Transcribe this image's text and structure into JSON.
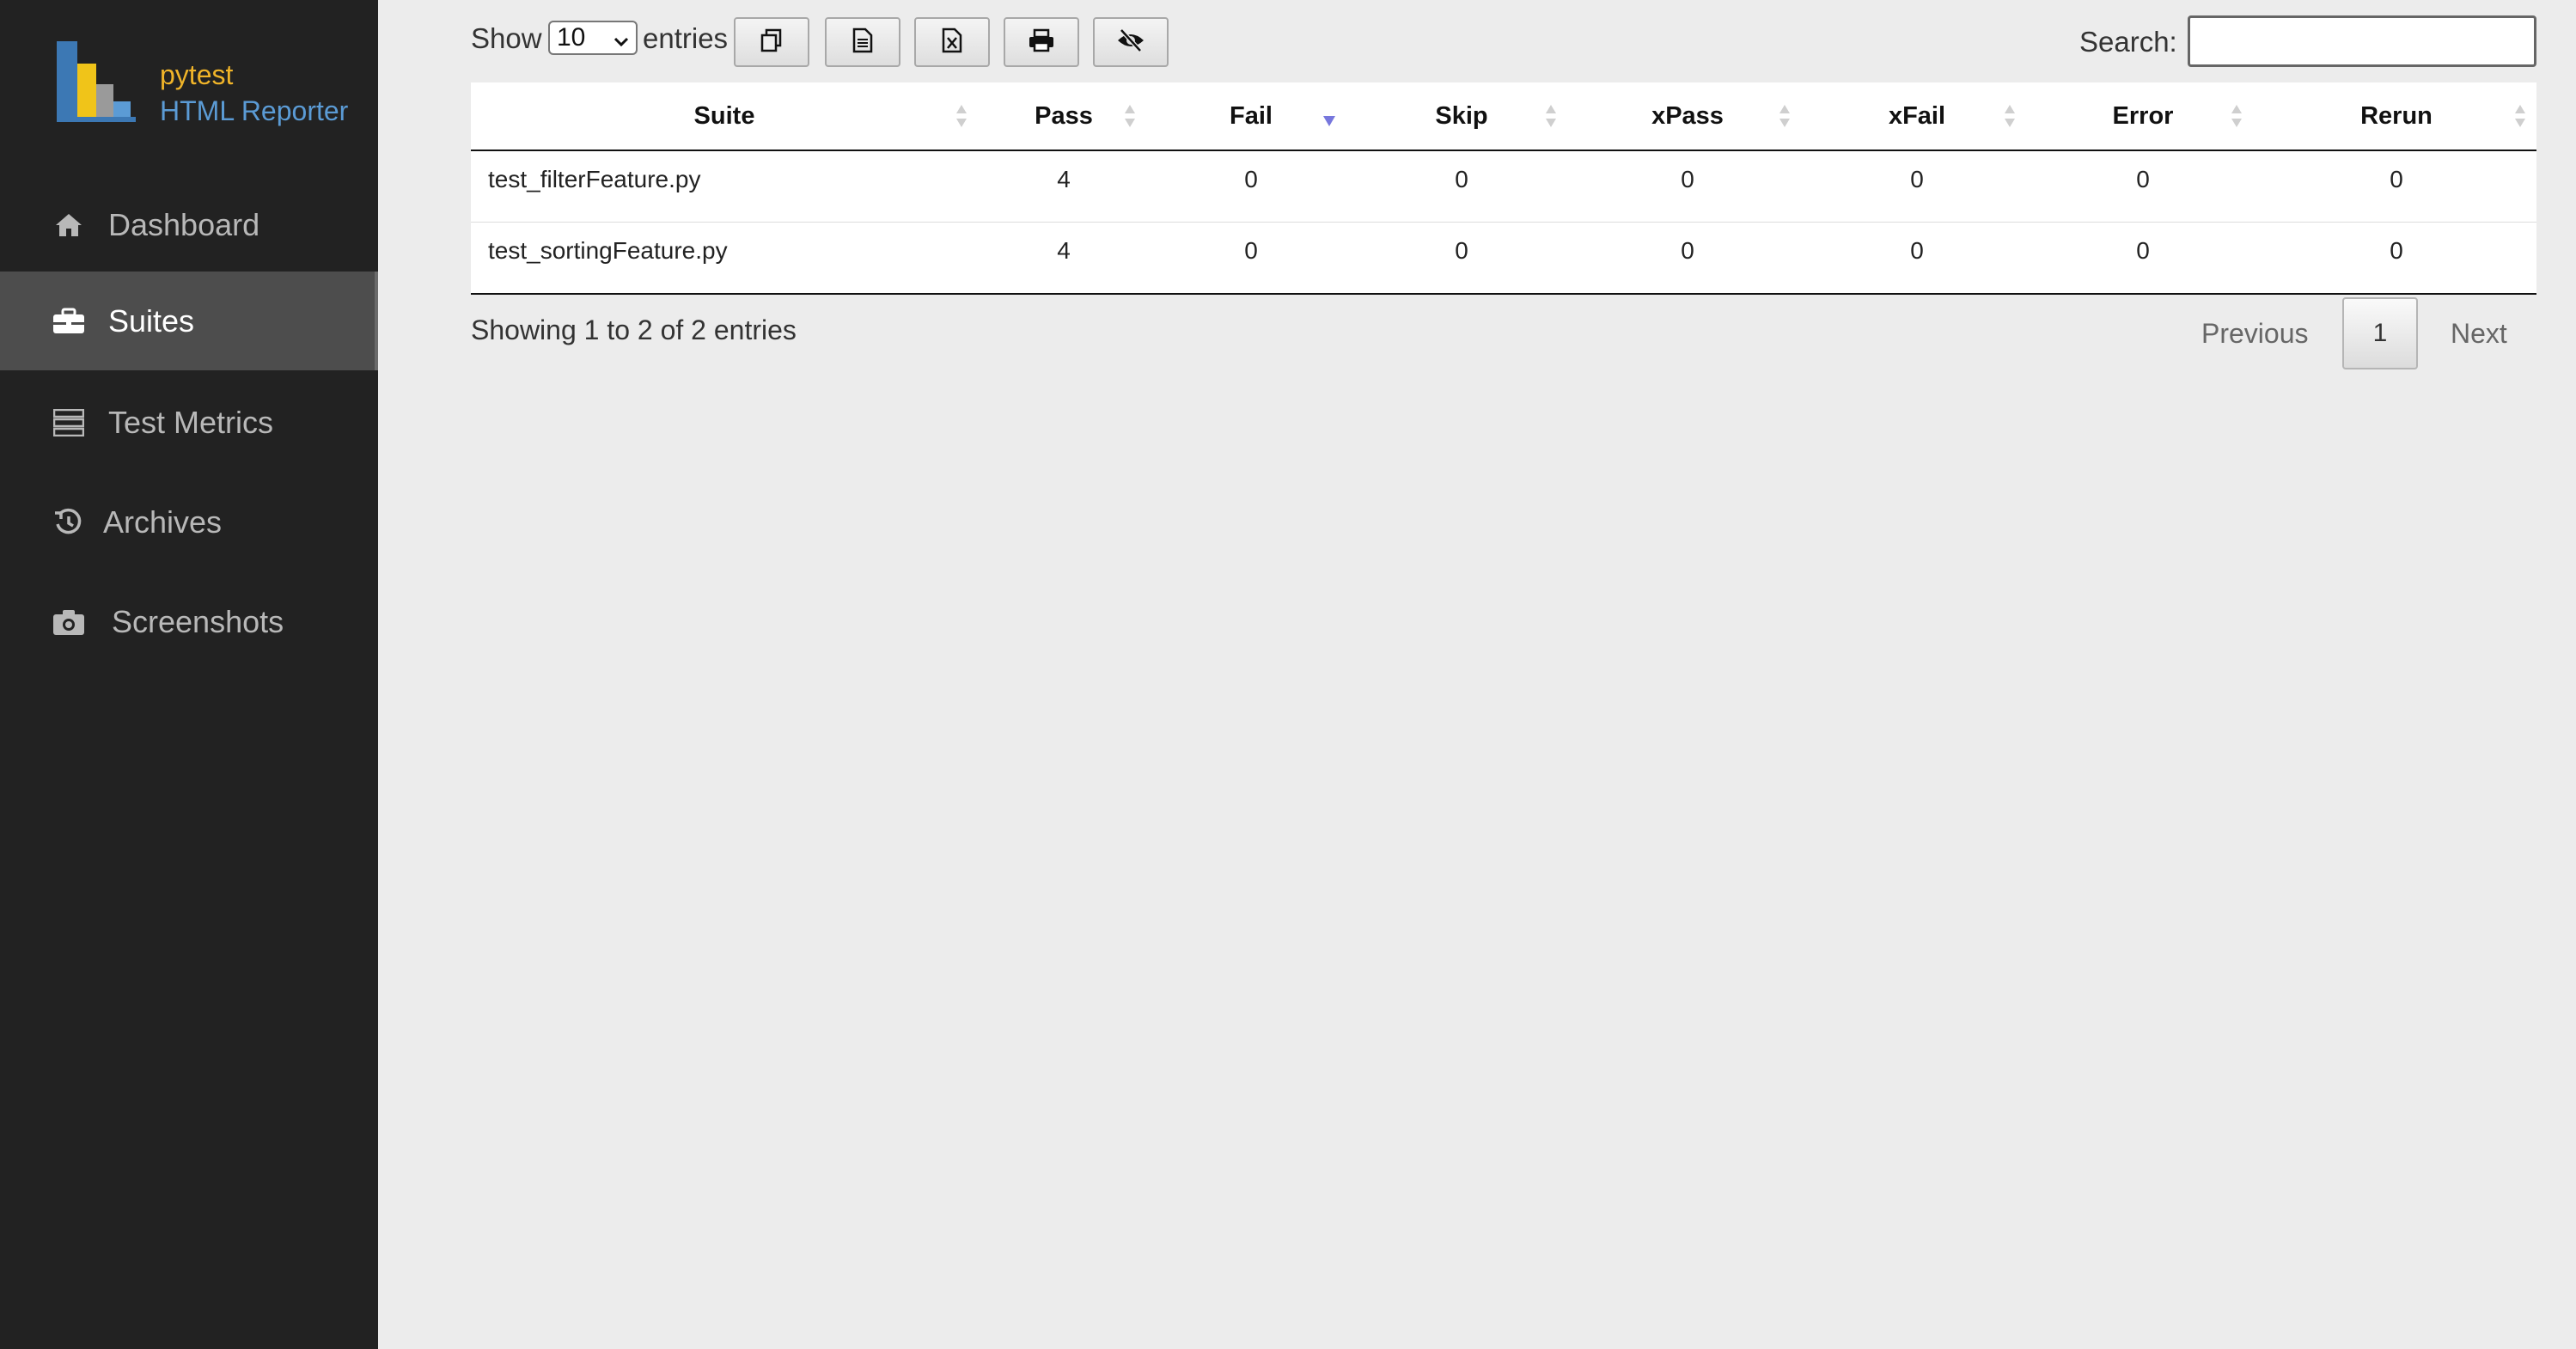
{
  "brand": {
    "line1": "pytest",
    "line2": "HTML Reporter",
    "logo_colors": [
      "#3c78b4",
      "#f0c419",
      "#9a9a9a",
      "#5b9bd5"
    ]
  },
  "sidebar": {
    "items": [
      {
        "label": "Dashboard",
        "icon": "home-icon",
        "active": false
      },
      {
        "label": "Suites",
        "icon": "briefcase-icon",
        "active": true
      },
      {
        "label": "Test Metrics",
        "icon": "server-icon",
        "active": false
      },
      {
        "label": "Archives",
        "icon": "history-icon",
        "active": false
      },
      {
        "label": "Screenshots",
        "icon": "camera-icon",
        "active": false
      }
    ]
  },
  "toolbar": {
    "show_label": "Show",
    "page_length": "10",
    "entries_label": "entries",
    "buttons": [
      {
        "name": "copy-button",
        "icon": "copy-icon"
      },
      {
        "name": "csv-button",
        "icon": "file-icon"
      },
      {
        "name": "excel-button",
        "icon": "excel-icon"
      },
      {
        "name": "print-button",
        "icon": "print-icon"
      },
      {
        "name": "column-visibility-button",
        "icon": "eye-slash-icon"
      }
    ],
    "search_label": "Search:",
    "search_value": ""
  },
  "table": {
    "columns": [
      "Suite",
      "Pass",
      "Fail",
      "Skip",
      "xPass",
      "xFail",
      "Error",
      "Rerun"
    ],
    "sorted_column": "Fail",
    "sort_direction": "descending",
    "sort_active_color": "#7777dd",
    "rows": [
      [
        "test_filterFeature.py",
        "4",
        "0",
        "0",
        "0",
        "0",
        "0",
        "0"
      ],
      [
        "test_sortingFeature.py",
        "4",
        "0",
        "0",
        "0",
        "0",
        "0",
        "0"
      ]
    ]
  },
  "footer": {
    "info": "Showing 1 to 2 of 2 entries",
    "previous_label": "Previous",
    "current_page": "1",
    "next_label": "Next"
  }
}
